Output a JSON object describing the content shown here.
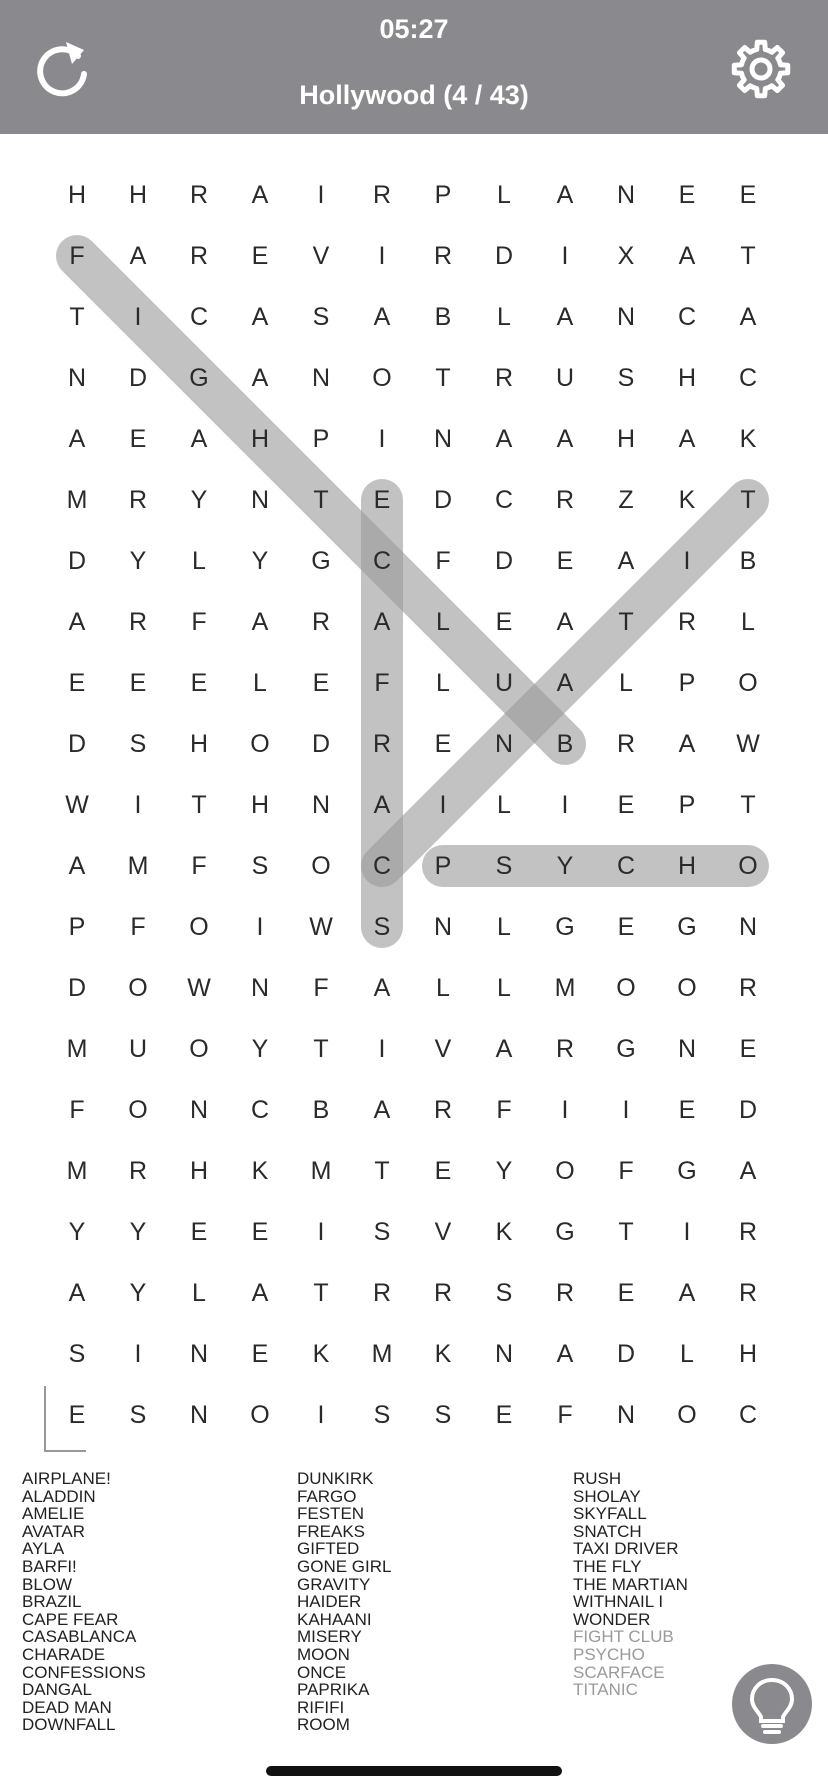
{
  "header": {
    "timer": "05:27",
    "title": "Hollywood (4 / 43)",
    "background": "#8a8a8e",
    "restart_icon": "restart-icon",
    "settings_icon": "gear-icon"
  },
  "grid": {
    "rows": [
      "HHRAIRPLANEE",
      "FAREVIRDIXAT",
      "TICASABLANCA",
      "NDGANOTRUSHC",
      "AEAHPINAAHAK",
      "MRYNTEDCRZKT",
      "DYLYGCFDEAIB",
      "ARFARALEATRL",
      "EEELEFLUALPO",
      "DSHODRENBRAW",
      "WITHNAILIEPT",
      "AMFSOCPSYCHO",
      "PFOIWSNLGEGN",
      "DOWNFALLMOOR",
      "MUOYTIVARGNE",
      "FONCBARFIIED",
      "MRHKMTEYOFGA",
      "YYEEISVKGTIR",
      "AYLATRRSREAR",
      "SINEKMKNADLH",
      "ESNOISSEFNOC"
    ],
    "found_words": [
      {
        "word": "FIGHT CLUB",
        "start": [
          1,
          0
        ],
        "end": [
          9,
          8
        ]
      },
      {
        "word": "SCARFACE",
        "start": [
          12,
          5
        ],
        "end": [
          5,
          5
        ]
      },
      {
        "word": "TITANIC",
        "start": [
          5,
          11
        ],
        "end": [
          11,
          5
        ]
      },
      {
        "word": "PSYCHO",
        "start": [
          11,
          6
        ],
        "end": [
          11,
          11
        ]
      }
    ],
    "highlight_color": "#9a9a9a"
  },
  "word_list": {
    "columns": [
      [
        "AIRPLANE!",
        "ALADDIN",
        "AMELIE",
        "AVATAR",
        "AYLA",
        "BARFI!",
        "BLOW",
        "BRAZIL",
        "CAPE FEAR",
        "CASABLANCA",
        "CHARADE",
        "CONFESSIONS",
        "DANGAL",
        "DEAD MAN",
        "DOWNFALL"
      ],
      [
        "DUNKIRK",
        "FARGO",
        "FESTEN",
        "FREAKS",
        "GIFTED",
        "GONE GIRL",
        "GRAVITY",
        "HAIDER",
        "KAHAANI",
        "MISERY",
        "MOON",
        "ONCE",
        "PAPRIKA",
        "RIFIFI",
        "ROOM"
      ],
      [
        "RUSH",
        "SHOLAY",
        "SKYFALL",
        "SNATCH",
        "TAXI DRIVER",
        "THE FLY",
        "THE MARTIAN",
        "WITHNAIL  I",
        "WONDER",
        "FIGHT CLUB",
        "PSYCHO",
        "SCARFACE",
        "TITANIC"
      ]
    ],
    "found": [
      "FIGHT CLUB",
      "PSYCHO",
      "SCARFACE",
      "TITANIC"
    ]
  },
  "hint": {
    "icon": "lightbulb-icon"
  }
}
